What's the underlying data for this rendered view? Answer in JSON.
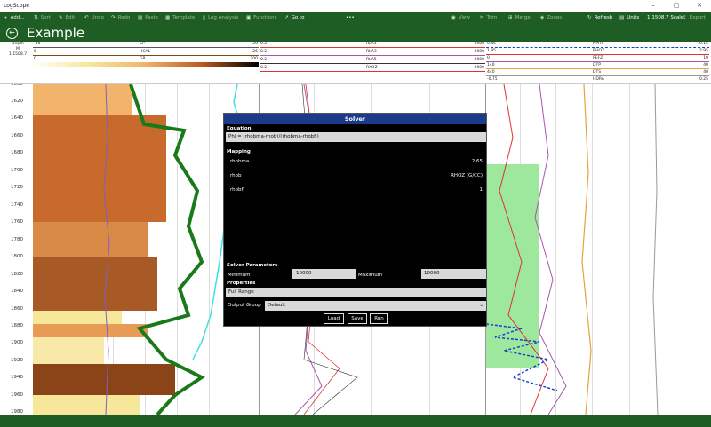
{
  "window": {
    "title": "LogScope",
    "minimize": "–",
    "maximize": "▢",
    "close": "✕"
  },
  "toolbar": {
    "add": "Add...",
    "sort": "Sort",
    "edit": "Edit",
    "undo": "Undo",
    "redo": "Redo",
    "paste": "Paste",
    "template": "Template",
    "log_analysis": "Log Analysis",
    "functions": "Functions",
    "goto": "Go to",
    "more": "•••",
    "view": "View",
    "trim": "Trim",
    "merge": "Merge",
    "zones": "Zones",
    "refresh": "Refresh",
    "units": "Units",
    "scale_value": "1:1508.7",
    "scale": "Scale",
    "export": "Export"
  },
  "header": {
    "title": "Example"
  },
  "depth_header": {
    "line1": "Depth",
    "line2": "M",
    "line3": "1:1508.7"
  },
  "track1_curves": [
    {
      "left": "-80",
      "name": "SP",
      "right": "20"
    },
    {
      "left": "6",
      "name": "HCAL",
      "right": "26"
    },
    {
      "left": "0",
      "name": "GR",
      "right": "200"
    }
  ],
  "track2_curves": [
    {
      "left": "0.2",
      "name": "RLA1",
      "right": "2000"
    },
    {
      "left": "0.2",
      "name": "RLA3",
      "right": "2000"
    },
    {
      "left": "0.2",
      "name": "RLA5",
      "right": "2000"
    },
    {
      "left": "0.2",
      "name": "RXOZ",
      "right": "2000"
    }
  ],
  "track3_curves": [
    {
      "left": "0.45",
      "name": "NPHI",
      "right": "-0.15"
    },
    {
      "left": "1.95",
      "name": "RHOZ",
      "right": "2.95"
    },
    {
      "left": "0",
      "name": "PEFZ",
      "right": "10"
    },
    {
      "left": "140",
      "name": "DTP",
      "right": "40"
    },
    {
      "left": "440",
      "name": "DTS",
      "right": "40"
    },
    {
      "left": "-0.75",
      "name": "HDRA",
      "right": "0.25"
    }
  ],
  "depth_ticks": [
    "1600",
    "1620",
    "1640",
    "1660",
    "1680",
    "1700",
    "1720",
    "1740",
    "1760",
    "1780",
    "1800",
    "1820",
    "1840",
    "1860",
    "1880",
    "1900",
    "1920",
    "1940",
    "1960",
    "1980"
  ],
  "solver": {
    "title": "Solver",
    "equation_label": "Equation",
    "equation": "Phi = (rhobma-rhob)/(rhobma-rhobfl)",
    "mapping_label": "Mapping",
    "mapping": [
      {
        "name": "rhobma",
        "value": "2,65"
      },
      {
        "name": "rhob",
        "value": "RHOZ (G/CC)"
      },
      {
        "name": "rhobfl",
        "value": "1"
      }
    ],
    "params_label": "Solver Parameters",
    "min_label": "Minimum",
    "min_value": "-10000",
    "max_label": "Maximum",
    "max_value": "10000",
    "properties_label": "Properties",
    "full_range": "Full Range",
    "output_group_label": "Output Group",
    "output_group_value": "Default",
    "load": "Load",
    "save": "Save",
    "run": "Run"
  },
  "colors": {
    "accent": "#1e5e24",
    "solver_header": "#1c3a8a"
  }
}
